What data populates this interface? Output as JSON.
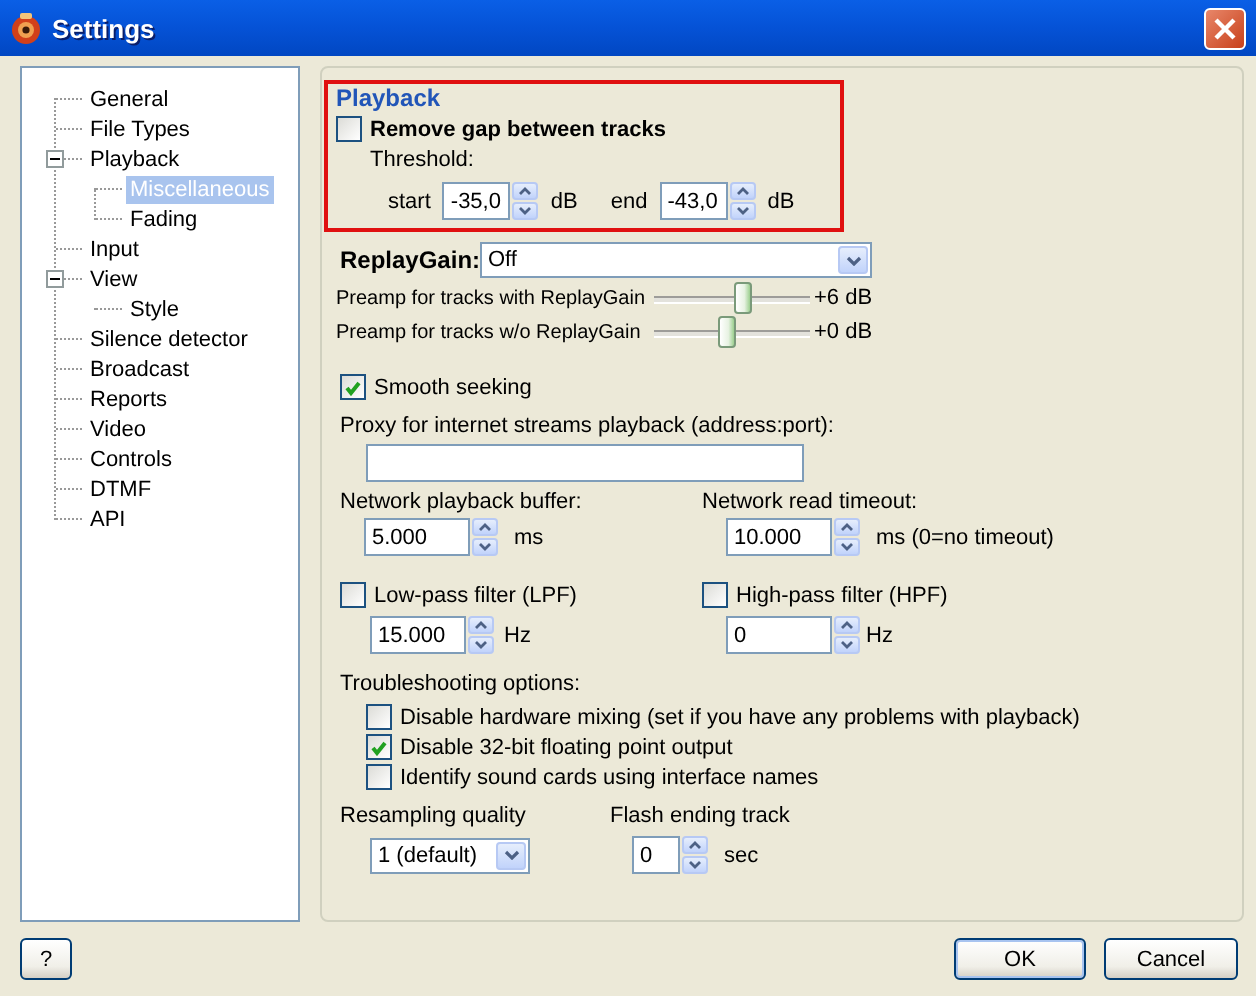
{
  "window": {
    "title": "Settings"
  },
  "tree": [
    {
      "label": "General",
      "selected": false
    },
    {
      "label": "File Types",
      "selected": false
    },
    {
      "label": "Playback",
      "selected": false,
      "expanded": true,
      "children": [
        {
          "label": "Miscellaneous",
          "selected": true
        },
        {
          "label": "Fading",
          "selected": false
        }
      ]
    },
    {
      "label": "Input",
      "selected": false
    },
    {
      "label": "View",
      "selected": false,
      "expanded": true,
      "children": [
        {
          "label": "Style",
          "selected": false
        }
      ]
    },
    {
      "label": "Silence detector",
      "selected": false
    },
    {
      "label": "Broadcast",
      "selected": false
    },
    {
      "label": "Reports",
      "selected": false
    },
    {
      "label": "Video",
      "selected": false
    },
    {
      "label": "Controls",
      "selected": false
    },
    {
      "label": "DTMF",
      "selected": false
    },
    {
      "label": "API",
      "selected": false
    }
  ],
  "section_title": "Playback",
  "remove_gap": {
    "label": "Remove gap between tracks",
    "checked": false,
    "threshold_label": "Threshold:",
    "start_label": "start",
    "start_value": "-35,0",
    "start_unit": "dB",
    "end_label": "end",
    "end_value": "-43,0",
    "end_unit": "dB"
  },
  "replaygain": {
    "label": "ReplayGain:",
    "value": "Off"
  },
  "preamps": [
    {
      "label": "Preamp for tracks with ReplayGain",
      "level": 0.58,
      "reading": "+6 dB"
    },
    {
      "label": "Preamp for tracks w/o ReplayGain",
      "level": 0.47,
      "reading": "+0 dB"
    }
  ],
  "smooth_seeking": {
    "label": "Smooth seeking",
    "checked": true
  },
  "proxy": {
    "label": "Proxy for internet streams playback (address:port):"
  },
  "network_buffer": {
    "label": "Network playback buffer:",
    "value": "5.000",
    "unit": "ms"
  },
  "network_timeout": {
    "label": "Network read timeout:",
    "value": "10.000",
    "unit": "ms (0=no timeout)"
  },
  "lpf": {
    "label": "Low-pass filter (LPF)",
    "checked": false,
    "value": "15.000",
    "unit": "Hz"
  },
  "hpf": {
    "label": "High-pass filter (HPF)",
    "checked": false,
    "value": "0",
    "unit": "Hz"
  },
  "troubleshooting": {
    "label": "Troubleshooting options:",
    "options": [
      {
        "label": "Disable hardware mixing (set if you have any problems with playback)",
        "checked": false
      },
      {
        "label": "Disable 32-bit floating point output",
        "checked": true
      },
      {
        "label": "Identify sound cards using interface names",
        "checked": false
      }
    ]
  },
  "resampling": {
    "label": "Resampling quality",
    "value": "1 (default)"
  },
  "flash_ending": {
    "label": "Flash ending track",
    "value": "0",
    "unit": "sec"
  },
  "buttons": {
    "help": "?",
    "ok": "OK",
    "cancel": "Cancel"
  }
}
